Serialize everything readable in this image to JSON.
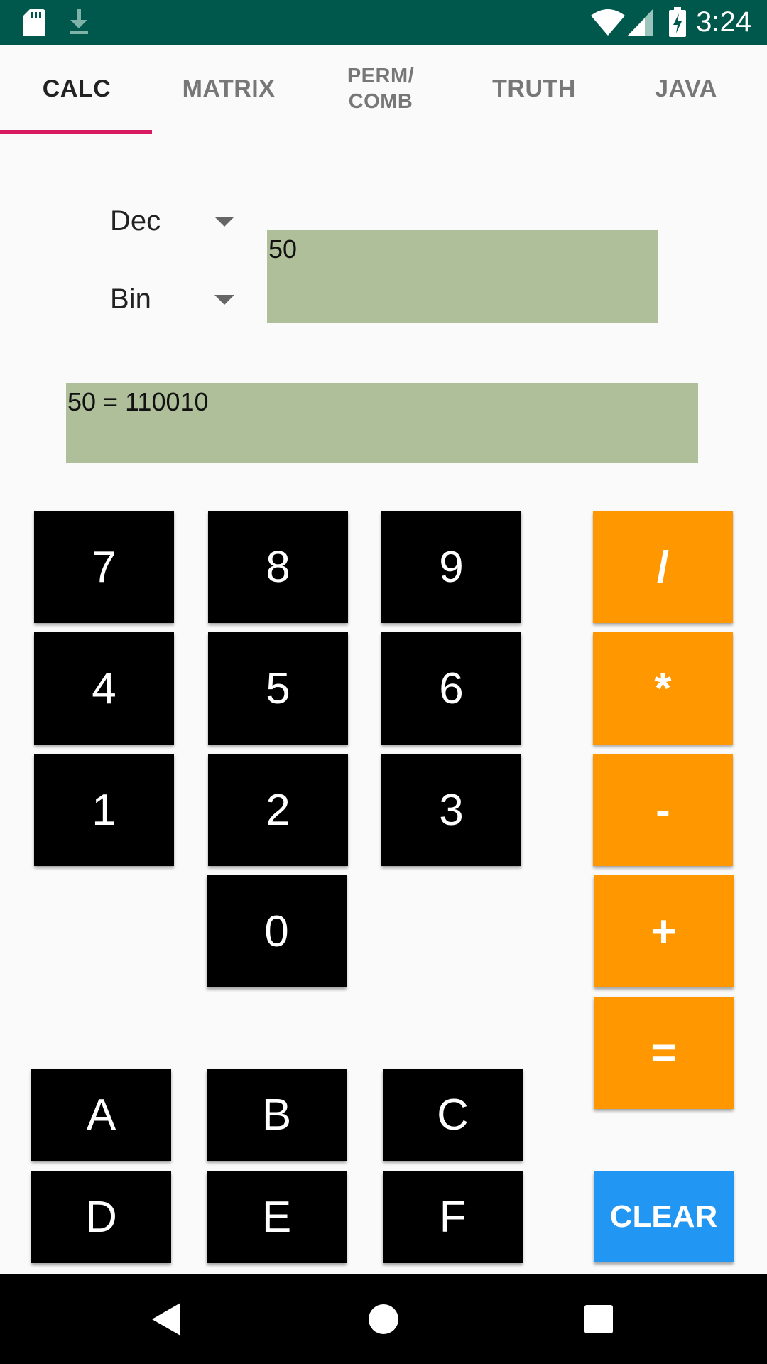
{
  "status_bar": {
    "time": "3:24"
  },
  "tabs": [
    {
      "label": "CALC",
      "active": true
    },
    {
      "label": "MATRIX",
      "active": false
    },
    {
      "label": "PERM/\nCOMB",
      "active": false
    },
    {
      "label": "TRUTH",
      "active": false
    },
    {
      "label": "JAVA",
      "active": false
    }
  ],
  "converter": {
    "from_base": "Dec",
    "to_base": "Bin",
    "input_value": "50",
    "result": "50 = 110010"
  },
  "keypad": {
    "k7": "7",
    "k8": "8",
    "k9": "9",
    "k4": "4",
    "k5": "5",
    "k6": "6",
    "k1": "1",
    "k2": "2",
    "k3": "3",
    "k0": "0",
    "divide": "/",
    "multiply": "*",
    "subtract": "-",
    "add": "+",
    "equals": "=",
    "kA": "A",
    "kB": "B",
    "kC": "C",
    "kD": "D",
    "kE": "E",
    "kF": "F",
    "clear": "CLEAR"
  },
  "colors": {
    "status_bar": "#00574b",
    "tab_indicator": "#d81b60",
    "field_background": "#aebf99",
    "digit_key": "#000000",
    "operator_key": "#ff9800",
    "clear_key": "#2196f3"
  }
}
